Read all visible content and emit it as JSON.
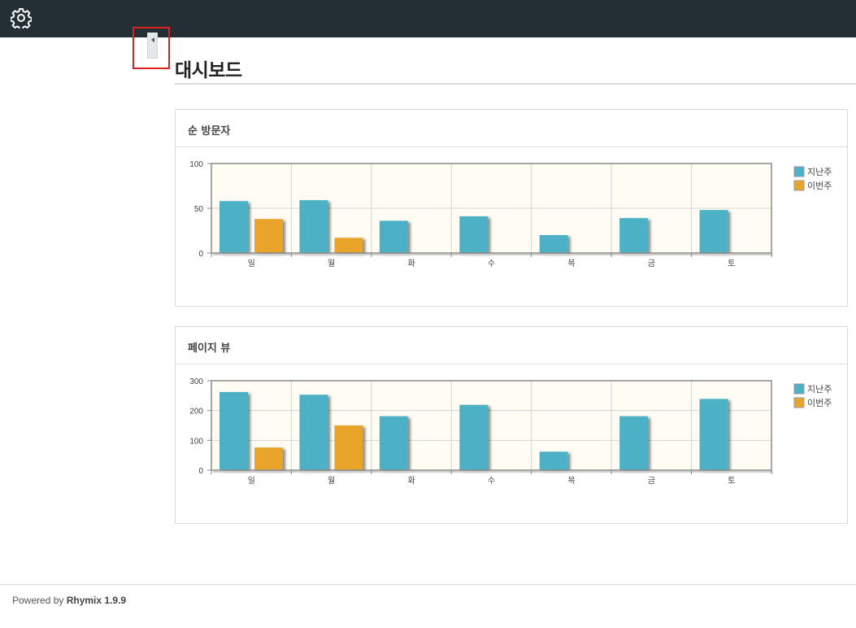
{
  "topbar": {
    "icon": "gear-icon",
    "background": "#242e35"
  },
  "page": {
    "title": "대시보드"
  },
  "footer": {
    "prefix": "Powered by ",
    "product": "Rhymix 1.9.9"
  },
  "colors": {
    "last_week": "#4db1c6",
    "this_week": "#e9a42c",
    "plot_bg": "#fffcf4"
  },
  "chart_data": [
    {
      "type": "bar",
      "title": "순 방문자",
      "categories": [
        "일",
        "월",
        "화",
        "수",
        "목",
        "금",
        "토"
      ],
      "ylim": [
        0,
        100
      ],
      "yticks": [
        "0",
        "50",
        "100"
      ],
      "grid": true,
      "legend": "right",
      "series": [
        {
          "name": "지난주",
          "values": [
            58,
            59,
            36,
            41,
            20,
            39,
            48
          ]
        },
        {
          "name": "이번주",
          "values": [
            38,
            17,
            0,
            0,
            0,
            0,
            0
          ]
        }
      ]
    },
    {
      "type": "bar",
      "title": "페이지 뷰",
      "categories": [
        "일",
        "월",
        "화",
        "수",
        "목",
        "금",
        "토"
      ],
      "ylim": [
        0,
        300
      ],
      "yticks": [
        "0",
        "100",
        "200",
        "300"
      ],
      "grid": true,
      "legend": "right",
      "series": [
        {
          "name": "지난주",
          "values": [
            262,
            253,
            181,
            219,
            62,
            181,
            239
          ]
        },
        {
          "name": "이번주",
          "values": [
            76,
            150,
            0,
            0,
            0,
            0,
            0
          ]
        }
      ]
    }
  ]
}
